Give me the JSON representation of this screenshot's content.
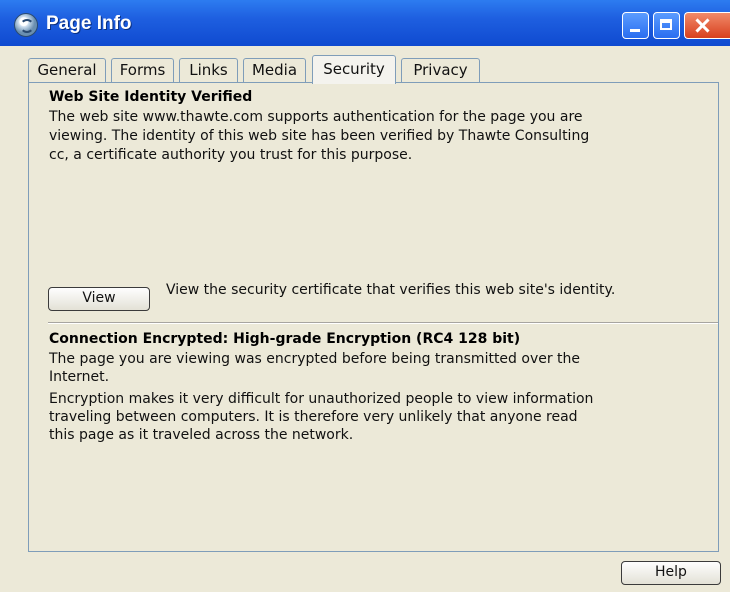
{
  "window": {
    "title": "Page Info"
  },
  "tabs": [
    {
      "label": "General"
    },
    {
      "label": "Forms"
    },
    {
      "label": "Links"
    },
    {
      "label": "Media"
    },
    {
      "label": "Security",
      "active": true
    },
    {
      "label": "Privacy"
    }
  ],
  "identity": {
    "heading": "Web Site Identity Verified",
    "lines": [
      "The web site www.thawte.com supports authentication for the page you are",
      "viewing. The identity of this web site has been verified by Thawte Consulting",
      "cc, a certificate authority you trust for this purpose."
    ],
    "view_button": "View",
    "view_hint": "View the security certificate that verifies this web site's identity."
  },
  "encryption": {
    "heading": "Connection Encrypted: High-grade Encryption (RC4 128 bit)",
    "para1": [
      "The page you are viewing was encrypted before being transmitted over the",
      "Internet."
    ],
    "para2": [
      "Encryption makes it very difficult for unauthorized people to view information",
      "traveling between computers. It is therefore very unlikely that anyone read",
      "this page as it traveled across the network."
    ]
  },
  "footer": {
    "help_button": "Help"
  }
}
